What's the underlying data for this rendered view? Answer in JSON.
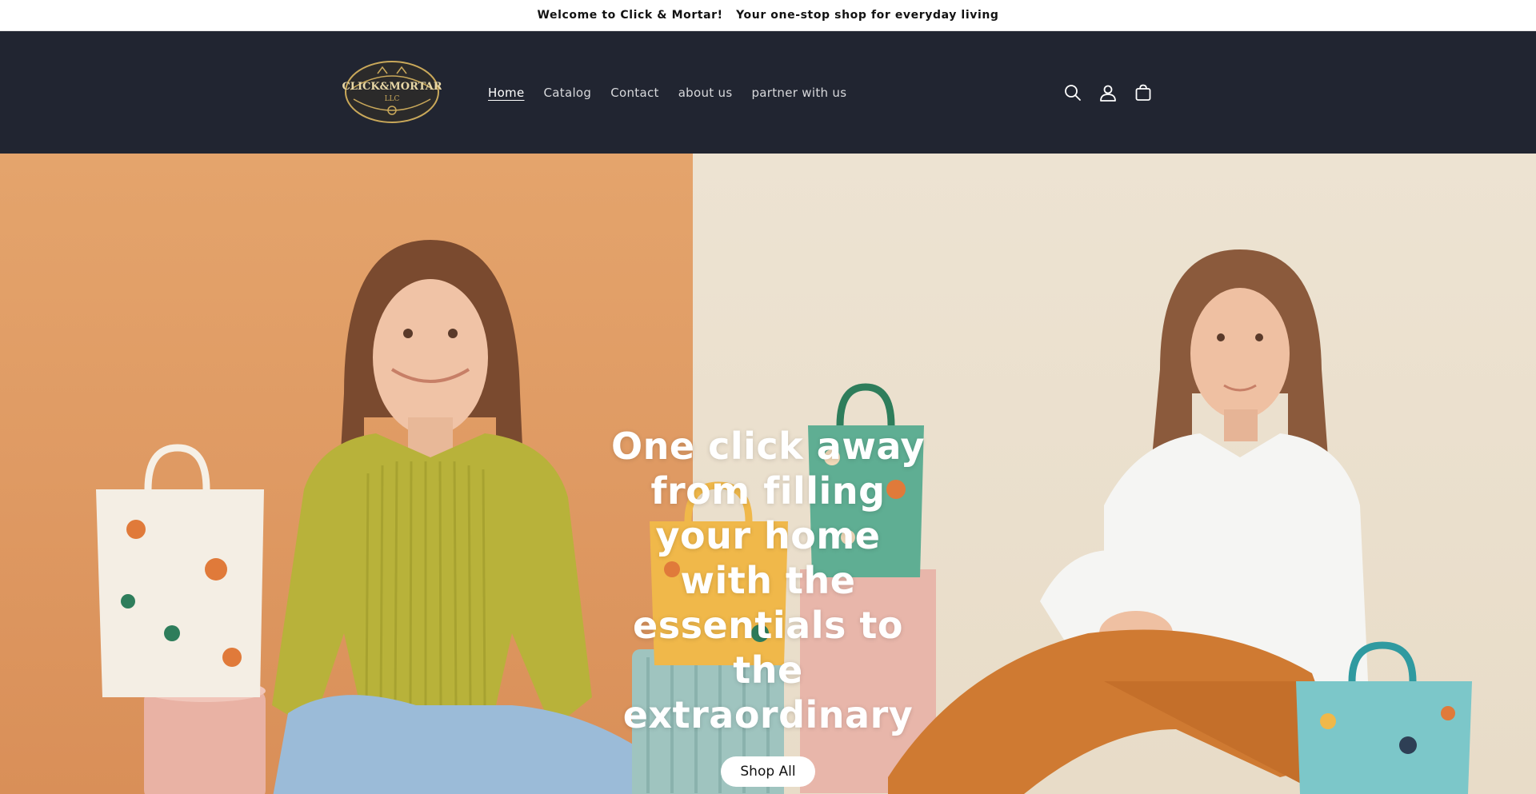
{
  "announcement": {
    "text": "Welcome to Click & Mortar!   Your one-stop shop for everyday living"
  },
  "header": {
    "logo_text": "CLICK & MORTAR LLC",
    "nav": [
      {
        "label": "Home",
        "active": true
      },
      {
        "label": "Catalog",
        "active": false
      },
      {
        "label": "Contact",
        "active": false
      },
      {
        "label": "about us",
        "active": false
      },
      {
        "label": "partner with us",
        "active": false
      }
    ],
    "icons": [
      "search-icon",
      "account-icon",
      "cart-icon"
    ]
  },
  "hero": {
    "title": "One click away from filling your home with the essentials to the extraordinary",
    "button_label": "Shop All"
  },
  "colors": {
    "header_bg": "#212531",
    "hero_left": "#e4a46c",
    "hero_right": "#ede3d2",
    "sweater": "#b8b23a",
    "pants": "#cf7a32"
  }
}
